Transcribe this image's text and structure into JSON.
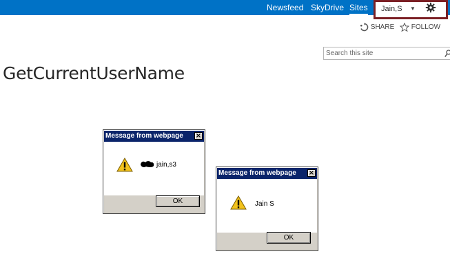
{
  "topbar": {
    "links": [
      "Newsfeed",
      "SkyDrive",
      "Sites"
    ],
    "active": "Sites",
    "user_name": "Jain,S",
    "icons": {
      "caret": "chevron-down-icon",
      "gear": "gear-icon"
    },
    "highlight_color": "#7b1f24",
    "bar_color": "#0072c6"
  },
  "actions": {
    "share_label": "SHARE",
    "follow_label": "FOLLOW"
  },
  "search": {
    "placeholder": "Search this site"
  },
  "page": {
    "title": "GetCurrentUserName"
  },
  "dialogs": [
    {
      "title": "Message from webpage",
      "message": "jain,s3",
      "button": "OK",
      "icon": "warning-icon",
      "has_redaction": true
    },
    {
      "title": "Message from webpage",
      "message": "Jain S",
      "button": "OK",
      "icon": "warning-icon",
      "has_redaction": false
    }
  ]
}
